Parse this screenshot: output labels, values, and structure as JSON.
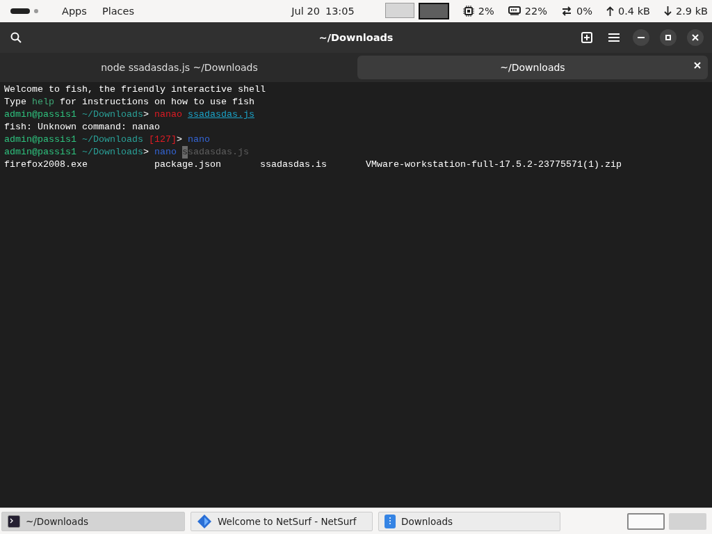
{
  "top_bar": {
    "menus": [
      "Apps",
      "Places"
    ],
    "date": "Jul 20",
    "time": "13:05",
    "workspaces": [
      {
        "selected": false
      },
      {
        "selected": true
      }
    ],
    "indicators": [
      {
        "kind": "cpu",
        "text": "2%"
      },
      {
        "kind": "memory",
        "text": "22%"
      },
      {
        "kind": "swap",
        "text": "0%"
      },
      {
        "kind": "upload",
        "text": "0.4 kB"
      },
      {
        "kind": "download",
        "text": "2.9 kB"
      }
    ]
  },
  "window": {
    "title": "~/Downloads"
  },
  "tabs": [
    {
      "label": "node ssadasdas.js ~/Downloads",
      "selected": false
    },
    {
      "label": "~/Downloads",
      "selected": true
    }
  ],
  "terminal": {
    "lines": [
      [
        {
          "kind": "plain",
          "text": "Welcome to fish, the friendly interactive shell"
        }
      ],
      [
        {
          "kind": "plain",
          "text": "Type "
        },
        {
          "kind": "help",
          "text": "help"
        },
        {
          "kind": "plain",
          "text": " for instructions on how to use fish"
        }
      ],
      [
        {
          "kind": "user",
          "text": "admin@passis1"
        },
        {
          "kind": "path",
          "text": " ~/Downloads"
        },
        {
          "kind": "plain",
          "text": "> "
        },
        {
          "kind": "error",
          "text": "nanao "
        },
        {
          "kind": "file",
          "text": "ssadasdas.js"
        }
      ],
      [
        {
          "kind": "plain",
          "text": "fish: Unknown command: nanao"
        }
      ],
      [
        {
          "kind": "user",
          "text": "admin@passis1"
        },
        {
          "kind": "path",
          "text": " ~/Downloads "
        },
        {
          "kind": "status",
          "text": "[127]"
        },
        {
          "kind": "plain",
          "text": "> "
        },
        {
          "kind": "command",
          "text": "nano"
        }
      ],
      [
        {
          "kind": "user",
          "text": "admin@passis1"
        },
        {
          "kind": "path",
          "text": " ~/Downloads"
        },
        {
          "kind": "plain",
          "text": "> "
        },
        {
          "kind": "command",
          "text": "nano "
        },
        {
          "kind": "cursor",
          "text": "s"
        },
        {
          "kind": "suggestion",
          "text": "sadasdas.js"
        }
      ]
    ],
    "listing": [
      "firefox2008.exe",
      "package.json",
      "ssadasdas.is",
      "VMware-workstation-full-17.5.2-23775571(1).zip"
    ]
  },
  "taskbar": {
    "items": [
      {
        "kind": "terminal",
        "label": "~/Downloads",
        "selected": true
      },
      {
        "kind": "browser",
        "label": "Welcome to NetSurf - NetSurf",
        "selected": false
      },
      {
        "kind": "files",
        "label": "Downloads",
        "selected": false
      }
    ],
    "workspaces": [
      {
        "selected": true
      },
      {
        "selected": false
      }
    ]
  }
}
